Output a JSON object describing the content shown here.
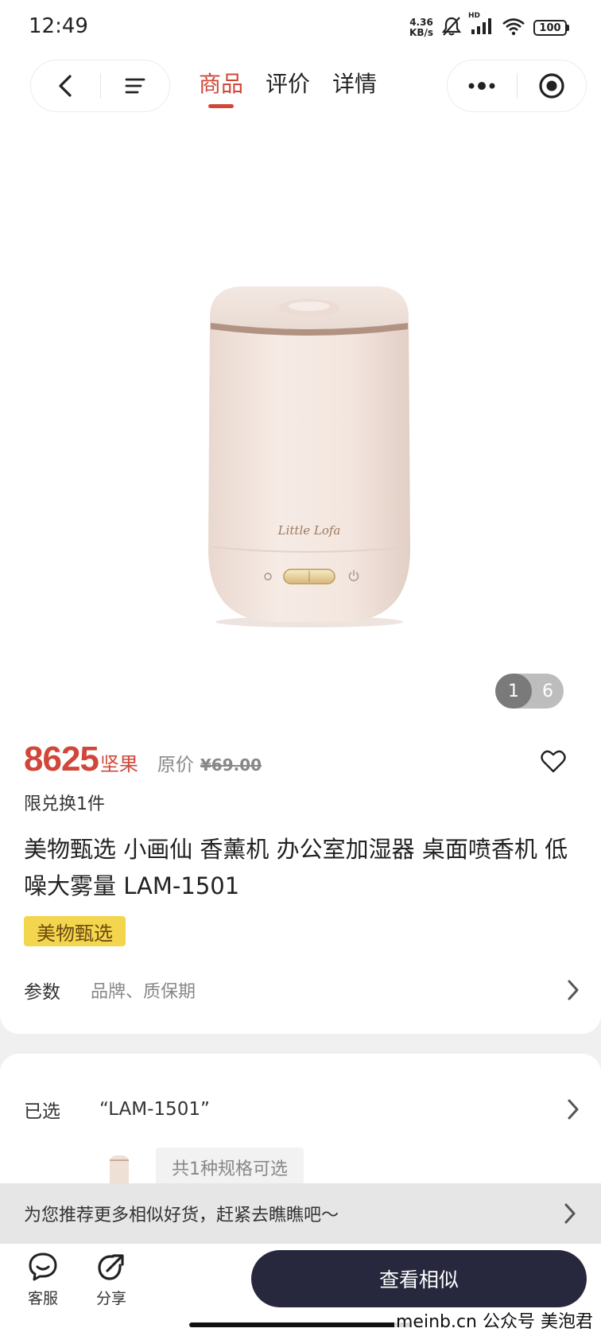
{
  "status_bar": {
    "time": "12:49",
    "net_speed_value": "4.36",
    "net_speed_unit": "KB/s",
    "signal_label": "HD",
    "battery": "100"
  },
  "nav": {
    "tabs": [
      {
        "label": "商品",
        "active": true
      },
      {
        "label": "评价",
        "active": false
      },
      {
        "label": "详情",
        "active": false
      }
    ]
  },
  "gallery": {
    "current_page": "1",
    "total_pages": "6",
    "product_logo": "Little Lofa"
  },
  "product": {
    "price": "8625",
    "price_unit": "坚果",
    "original_price_label": "原价",
    "original_price": "¥69.00",
    "limit_text": "限兑换1件",
    "title": "美物甄选 小画仙 香薰机 办公室加湿器 桌面喷香机 低噪大雾量 LAM-1501",
    "tag": "美物甄选",
    "params_label": "参数",
    "params_value": "品牌、质保期"
  },
  "spec": {
    "selected_label": "已选",
    "selected_value": "“LAM-1501”",
    "spec_count": "共1种规格可选"
  },
  "recommend": {
    "text": "为您推荐更多相似好货，赶紧去瞧瞧吧～"
  },
  "bottom_bar": {
    "service_label": "客服",
    "share_label": "分享",
    "cta_label": "查看相似"
  },
  "watermark": "meinb.cn  公众号 美泡君",
  "colors": {
    "accent": "#d0473a",
    "tag_bg": "#f3d54e",
    "cta_bg": "#27283d"
  }
}
